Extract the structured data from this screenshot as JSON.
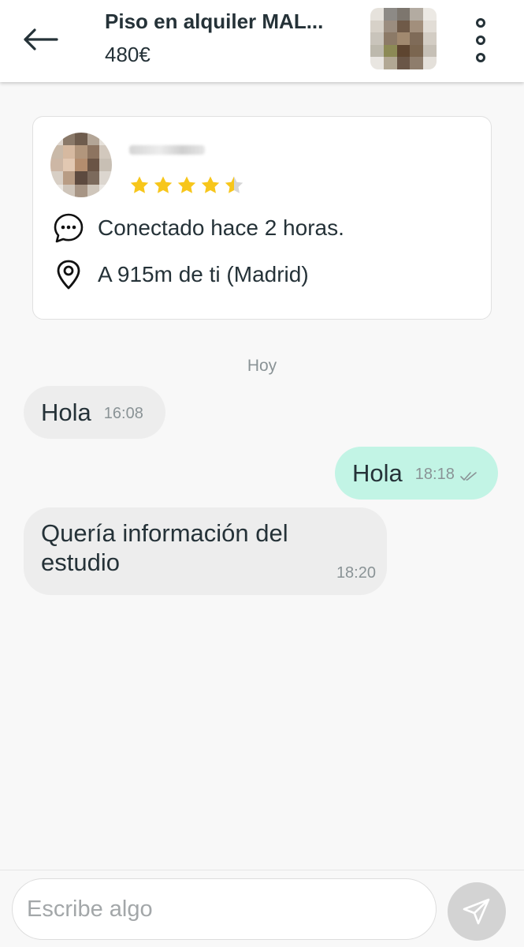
{
  "header": {
    "title": "Piso en alquiler MAL...",
    "price": "480€",
    "back_icon": "arrow-left-icon",
    "more_icon": "more-vertical-icon"
  },
  "seller": {
    "rating": 4.5,
    "rating_max": 5,
    "status": "Conectado hace 2 horas.",
    "status_icon": "chat-bubble-icon",
    "location": "A 915m de ti (Madrid)",
    "location_icon": "location-pin-icon"
  },
  "chat": {
    "day_label": "Hoy",
    "messages": [
      {
        "direction": "incoming",
        "text": "Hola",
        "time": "16:08"
      },
      {
        "direction": "outgoing",
        "text": "Hola",
        "time": "18:18",
        "status_icon": "double-check-icon"
      },
      {
        "direction": "incoming",
        "text": "Quería información del estudio",
        "time": "18:20"
      }
    ]
  },
  "composer": {
    "placeholder": "Escribe algo",
    "send_icon": "send-icon"
  },
  "colors": {
    "outgoing_bubble": "#c2f4e5",
    "incoming_bubble": "#ededed",
    "star": "#f7c61b",
    "text": "#253238",
    "send_button": "#d3d3d3"
  }
}
